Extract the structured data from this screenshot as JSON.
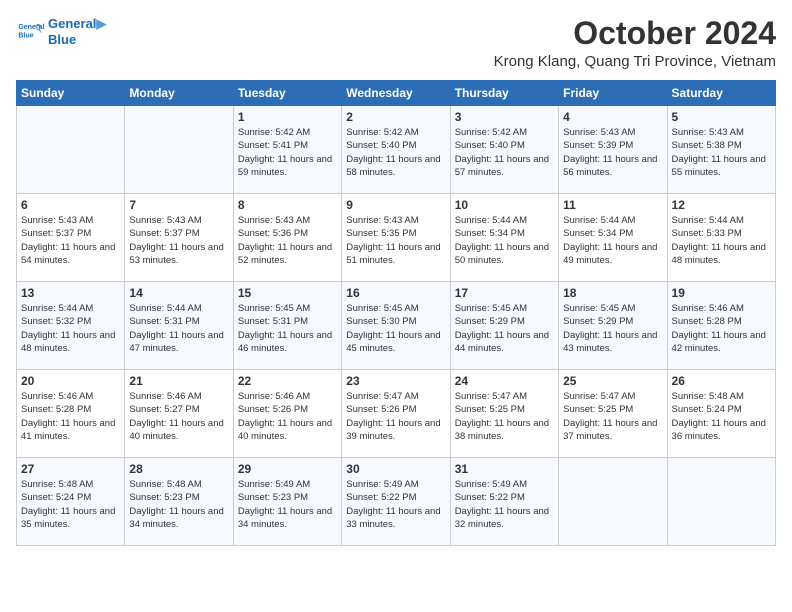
{
  "header": {
    "logo_line1": "General",
    "logo_line2": "Blue",
    "month": "October 2024",
    "location": "Krong Klang, Quang Tri Province, Vietnam"
  },
  "days_of_week": [
    "Sunday",
    "Monday",
    "Tuesday",
    "Wednesday",
    "Thursday",
    "Friday",
    "Saturday"
  ],
  "weeks": [
    [
      {
        "day": "",
        "sunrise": "",
        "sunset": "",
        "daylight": ""
      },
      {
        "day": "",
        "sunrise": "",
        "sunset": "",
        "daylight": ""
      },
      {
        "day": "1",
        "sunrise": "Sunrise: 5:42 AM",
        "sunset": "Sunset: 5:41 PM",
        "daylight": "Daylight: 11 hours and 59 minutes."
      },
      {
        "day": "2",
        "sunrise": "Sunrise: 5:42 AM",
        "sunset": "Sunset: 5:40 PM",
        "daylight": "Daylight: 11 hours and 58 minutes."
      },
      {
        "day": "3",
        "sunrise": "Sunrise: 5:42 AM",
        "sunset": "Sunset: 5:40 PM",
        "daylight": "Daylight: 11 hours and 57 minutes."
      },
      {
        "day": "4",
        "sunrise": "Sunrise: 5:43 AM",
        "sunset": "Sunset: 5:39 PM",
        "daylight": "Daylight: 11 hours and 56 minutes."
      },
      {
        "day": "5",
        "sunrise": "Sunrise: 5:43 AM",
        "sunset": "Sunset: 5:38 PM",
        "daylight": "Daylight: 11 hours and 55 minutes."
      }
    ],
    [
      {
        "day": "6",
        "sunrise": "Sunrise: 5:43 AM",
        "sunset": "Sunset: 5:37 PM",
        "daylight": "Daylight: 11 hours and 54 minutes."
      },
      {
        "day": "7",
        "sunrise": "Sunrise: 5:43 AM",
        "sunset": "Sunset: 5:37 PM",
        "daylight": "Daylight: 11 hours and 53 minutes."
      },
      {
        "day": "8",
        "sunrise": "Sunrise: 5:43 AM",
        "sunset": "Sunset: 5:36 PM",
        "daylight": "Daylight: 11 hours and 52 minutes."
      },
      {
        "day": "9",
        "sunrise": "Sunrise: 5:43 AM",
        "sunset": "Sunset: 5:35 PM",
        "daylight": "Daylight: 11 hours and 51 minutes."
      },
      {
        "day": "10",
        "sunrise": "Sunrise: 5:44 AM",
        "sunset": "Sunset: 5:34 PM",
        "daylight": "Daylight: 11 hours and 50 minutes."
      },
      {
        "day": "11",
        "sunrise": "Sunrise: 5:44 AM",
        "sunset": "Sunset: 5:34 PM",
        "daylight": "Daylight: 11 hours and 49 minutes."
      },
      {
        "day": "12",
        "sunrise": "Sunrise: 5:44 AM",
        "sunset": "Sunset: 5:33 PM",
        "daylight": "Daylight: 11 hours and 48 minutes."
      }
    ],
    [
      {
        "day": "13",
        "sunrise": "Sunrise: 5:44 AM",
        "sunset": "Sunset: 5:32 PM",
        "daylight": "Daylight: 11 hours and 48 minutes."
      },
      {
        "day": "14",
        "sunrise": "Sunrise: 5:44 AM",
        "sunset": "Sunset: 5:31 PM",
        "daylight": "Daylight: 11 hours and 47 minutes."
      },
      {
        "day": "15",
        "sunrise": "Sunrise: 5:45 AM",
        "sunset": "Sunset: 5:31 PM",
        "daylight": "Daylight: 11 hours and 46 minutes."
      },
      {
        "day": "16",
        "sunrise": "Sunrise: 5:45 AM",
        "sunset": "Sunset: 5:30 PM",
        "daylight": "Daylight: 11 hours and 45 minutes."
      },
      {
        "day": "17",
        "sunrise": "Sunrise: 5:45 AM",
        "sunset": "Sunset: 5:29 PM",
        "daylight": "Daylight: 11 hours and 44 minutes."
      },
      {
        "day": "18",
        "sunrise": "Sunrise: 5:45 AM",
        "sunset": "Sunset: 5:29 PM",
        "daylight": "Daylight: 11 hours and 43 minutes."
      },
      {
        "day": "19",
        "sunrise": "Sunrise: 5:46 AM",
        "sunset": "Sunset: 5:28 PM",
        "daylight": "Daylight: 11 hours and 42 minutes."
      }
    ],
    [
      {
        "day": "20",
        "sunrise": "Sunrise: 5:46 AM",
        "sunset": "Sunset: 5:28 PM",
        "daylight": "Daylight: 11 hours and 41 minutes."
      },
      {
        "day": "21",
        "sunrise": "Sunrise: 5:46 AM",
        "sunset": "Sunset: 5:27 PM",
        "daylight": "Daylight: 11 hours and 40 minutes."
      },
      {
        "day": "22",
        "sunrise": "Sunrise: 5:46 AM",
        "sunset": "Sunset: 5:26 PM",
        "daylight": "Daylight: 11 hours and 40 minutes."
      },
      {
        "day": "23",
        "sunrise": "Sunrise: 5:47 AM",
        "sunset": "Sunset: 5:26 PM",
        "daylight": "Daylight: 11 hours and 39 minutes."
      },
      {
        "day": "24",
        "sunrise": "Sunrise: 5:47 AM",
        "sunset": "Sunset: 5:25 PM",
        "daylight": "Daylight: 11 hours and 38 minutes."
      },
      {
        "day": "25",
        "sunrise": "Sunrise: 5:47 AM",
        "sunset": "Sunset: 5:25 PM",
        "daylight": "Daylight: 11 hours and 37 minutes."
      },
      {
        "day": "26",
        "sunrise": "Sunrise: 5:48 AM",
        "sunset": "Sunset: 5:24 PM",
        "daylight": "Daylight: 11 hours and 36 minutes."
      }
    ],
    [
      {
        "day": "27",
        "sunrise": "Sunrise: 5:48 AM",
        "sunset": "Sunset: 5:24 PM",
        "daylight": "Daylight: 11 hours and 35 minutes."
      },
      {
        "day": "28",
        "sunrise": "Sunrise: 5:48 AM",
        "sunset": "Sunset: 5:23 PM",
        "daylight": "Daylight: 11 hours and 34 minutes."
      },
      {
        "day": "29",
        "sunrise": "Sunrise: 5:49 AM",
        "sunset": "Sunset: 5:23 PM",
        "daylight": "Daylight: 11 hours and 34 minutes."
      },
      {
        "day": "30",
        "sunrise": "Sunrise: 5:49 AM",
        "sunset": "Sunset: 5:22 PM",
        "daylight": "Daylight: 11 hours and 33 minutes."
      },
      {
        "day": "31",
        "sunrise": "Sunrise: 5:49 AM",
        "sunset": "Sunset: 5:22 PM",
        "daylight": "Daylight: 11 hours and 32 minutes."
      },
      {
        "day": "",
        "sunrise": "",
        "sunset": "",
        "daylight": ""
      },
      {
        "day": "",
        "sunrise": "",
        "sunset": "",
        "daylight": ""
      }
    ]
  ]
}
